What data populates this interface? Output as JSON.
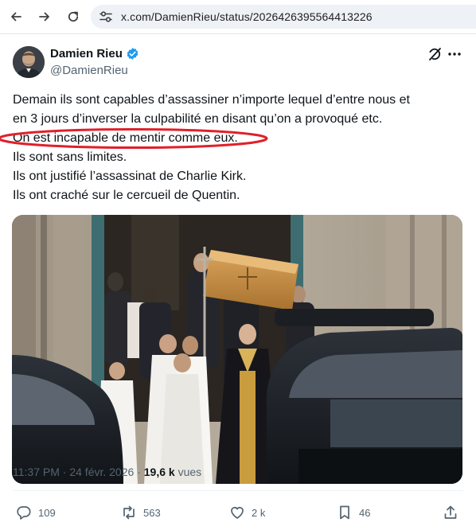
{
  "browser": {
    "url": "x.com/DamienRieu/status/2026426395564413226",
    "back_icon": "arrow-left-icon",
    "forward_icon": "arrow-right-icon",
    "reload_icon": "reload-icon",
    "site_info_icon": "tune-icon"
  },
  "tweet": {
    "author": {
      "display_name": "Damien Rieu",
      "handle": "@DamienRieu",
      "verified_color": "#1d9bf0"
    },
    "text_lines": [
      "Demain ils sont capables d’assassiner n’importe lequel d’entre nous et",
      "en 3 jours d’inverser la culpabilité en disant qu’on a provoqué etc.",
      "On est incapable de mentir comme eux.",
      "Ils sont sans limites.",
      "Ils ont justifié l’assassinat de Charlie Kirk.",
      "Ils ont craché sur le cercueil de Quentin."
    ],
    "highlight_color": "#e0202a",
    "time": "11:37 PM",
    "date": "24 févr. 2026",
    "separator": "·",
    "views_count": "19,6 k",
    "views_label": "vues",
    "actions": {
      "replies": "109",
      "reposts": "563",
      "likes": "2 k",
      "bookmarks": "46"
    }
  }
}
